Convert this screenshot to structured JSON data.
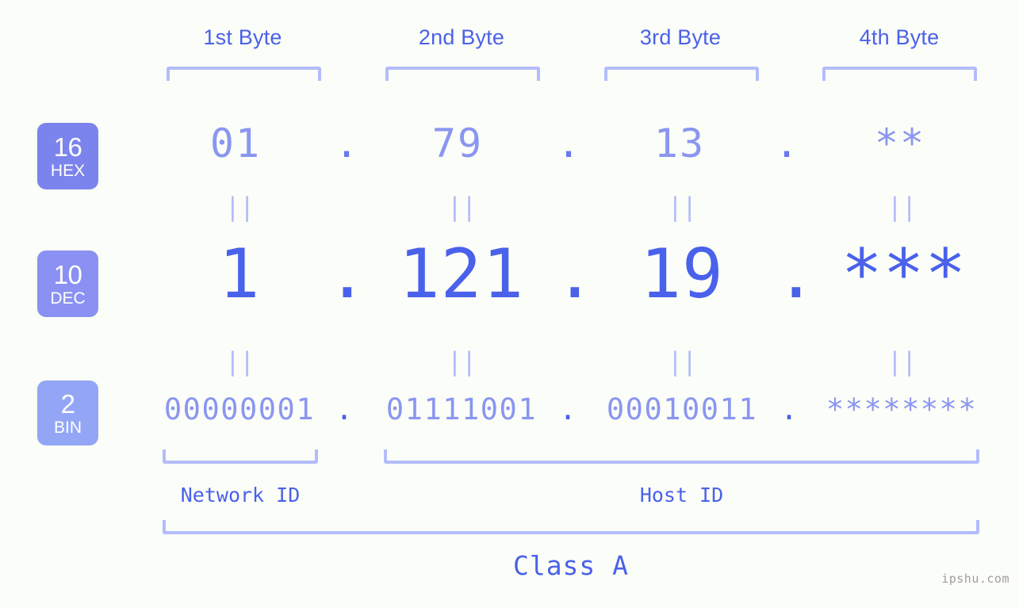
{
  "background_color": "#fbfdf8",
  "accent_colors": {
    "strong_blue": "#4a61ea",
    "mid_periwinkle": "#8a96f0",
    "light_periwinkle": "#b3bcfb",
    "badge_hex": "#7b83ec",
    "badge_dec": "#8a91f2",
    "badge_bin": "#93a6f5",
    "watermark_gray": "#9e9e9e"
  },
  "byte_headers": [
    {
      "label": "1st Byte"
    },
    {
      "label": "2nd Byte"
    },
    {
      "label": "3rd Byte"
    },
    {
      "label": "4th Byte"
    }
  ],
  "radix_badges": [
    {
      "number": "16",
      "system": "HEX"
    },
    {
      "number": "10",
      "system": "DEC"
    },
    {
      "number": "2",
      "system": "BIN"
    }
  ],
  "rows": {
    "hex": {
      "values": [
        "01",
        "79",
        "13",
        "**"
      ],
      "separator": "."
    },
    "dec": {
      "values": [
        "1",
        "121",
        "19",
        "***"
      ],
      "separator": "."
    },
    "bin": {
      "values": [
        "00000001",
        "01111001",
        "00010011",
        "********"
      ],
      "separator": "."
    }
  },
  "equals_symbol": "||",
  "segments": [
    {
      "label": "Network ID"
    },
    {
      "label": "Host ID"
    }
  ],
  "class_label": "Class A",
  "watermark": "ipshu.com"
}
